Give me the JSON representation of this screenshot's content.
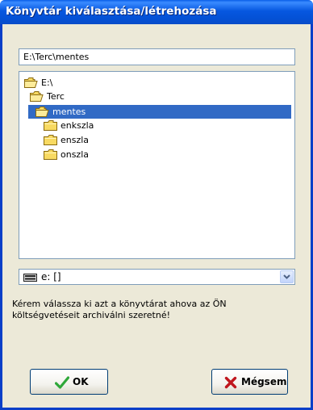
{
  "window": {
    "title": "Könyvtár kiválasztása/létrehozása"
  },
  "path_field": {
    "value": "E:\\Terc\\mentes"
  },
  "tree": {
    "nodes": [
      {
        "label": "E:\\",
        "icon": "open-folder-icon",
        "level": 0,
        "selected": false
      },
      {
        "label": "Terc",
        "icon": "open-folder-icon",
        "level": 1,
        "selected": false
      },
      {
        "label": "mentes",
        "icon": "open-folder-icon",
        "level": 2,
        "selected": true
      },
      {
        "label": "enkszla",
        "icon": "folder-icon",
        "level": 3,
        "selected": false
      },
      {
        "label": "enszla",
        "icon": "folder-icon",
        "level": 3,
        "selected": false
      },
      {
        "label": "onszla",
        "icon": "folder-icon",
        "level": 3,
        "selected": false
      }
    ]
  },
  "drive_select": {
    "value": "e: []",
    "icon": "drive-icon"
  },
  "message": "Kérem válassza ki azt a könyvtárat ahova az ÖN költségvetéseit archiválni szeretné!",
  "buttons": {
    "ok": {
      "label": "OK",
      "icon": "checkmark-icon"
    },
    "cancel": {
      "label": "Mégsem",
      "icon": "x-icon"
    }
  },
  "colors": {
    "title_bar": "#0A5FE8",
    "dialog_bg": "#ECE9D8",
    "selection": "#316AC5",
    "folder": "#F8DA62",
    "ok_check": "#2FA83A",
    "cancel_x": "#C0161E"
  }
}
